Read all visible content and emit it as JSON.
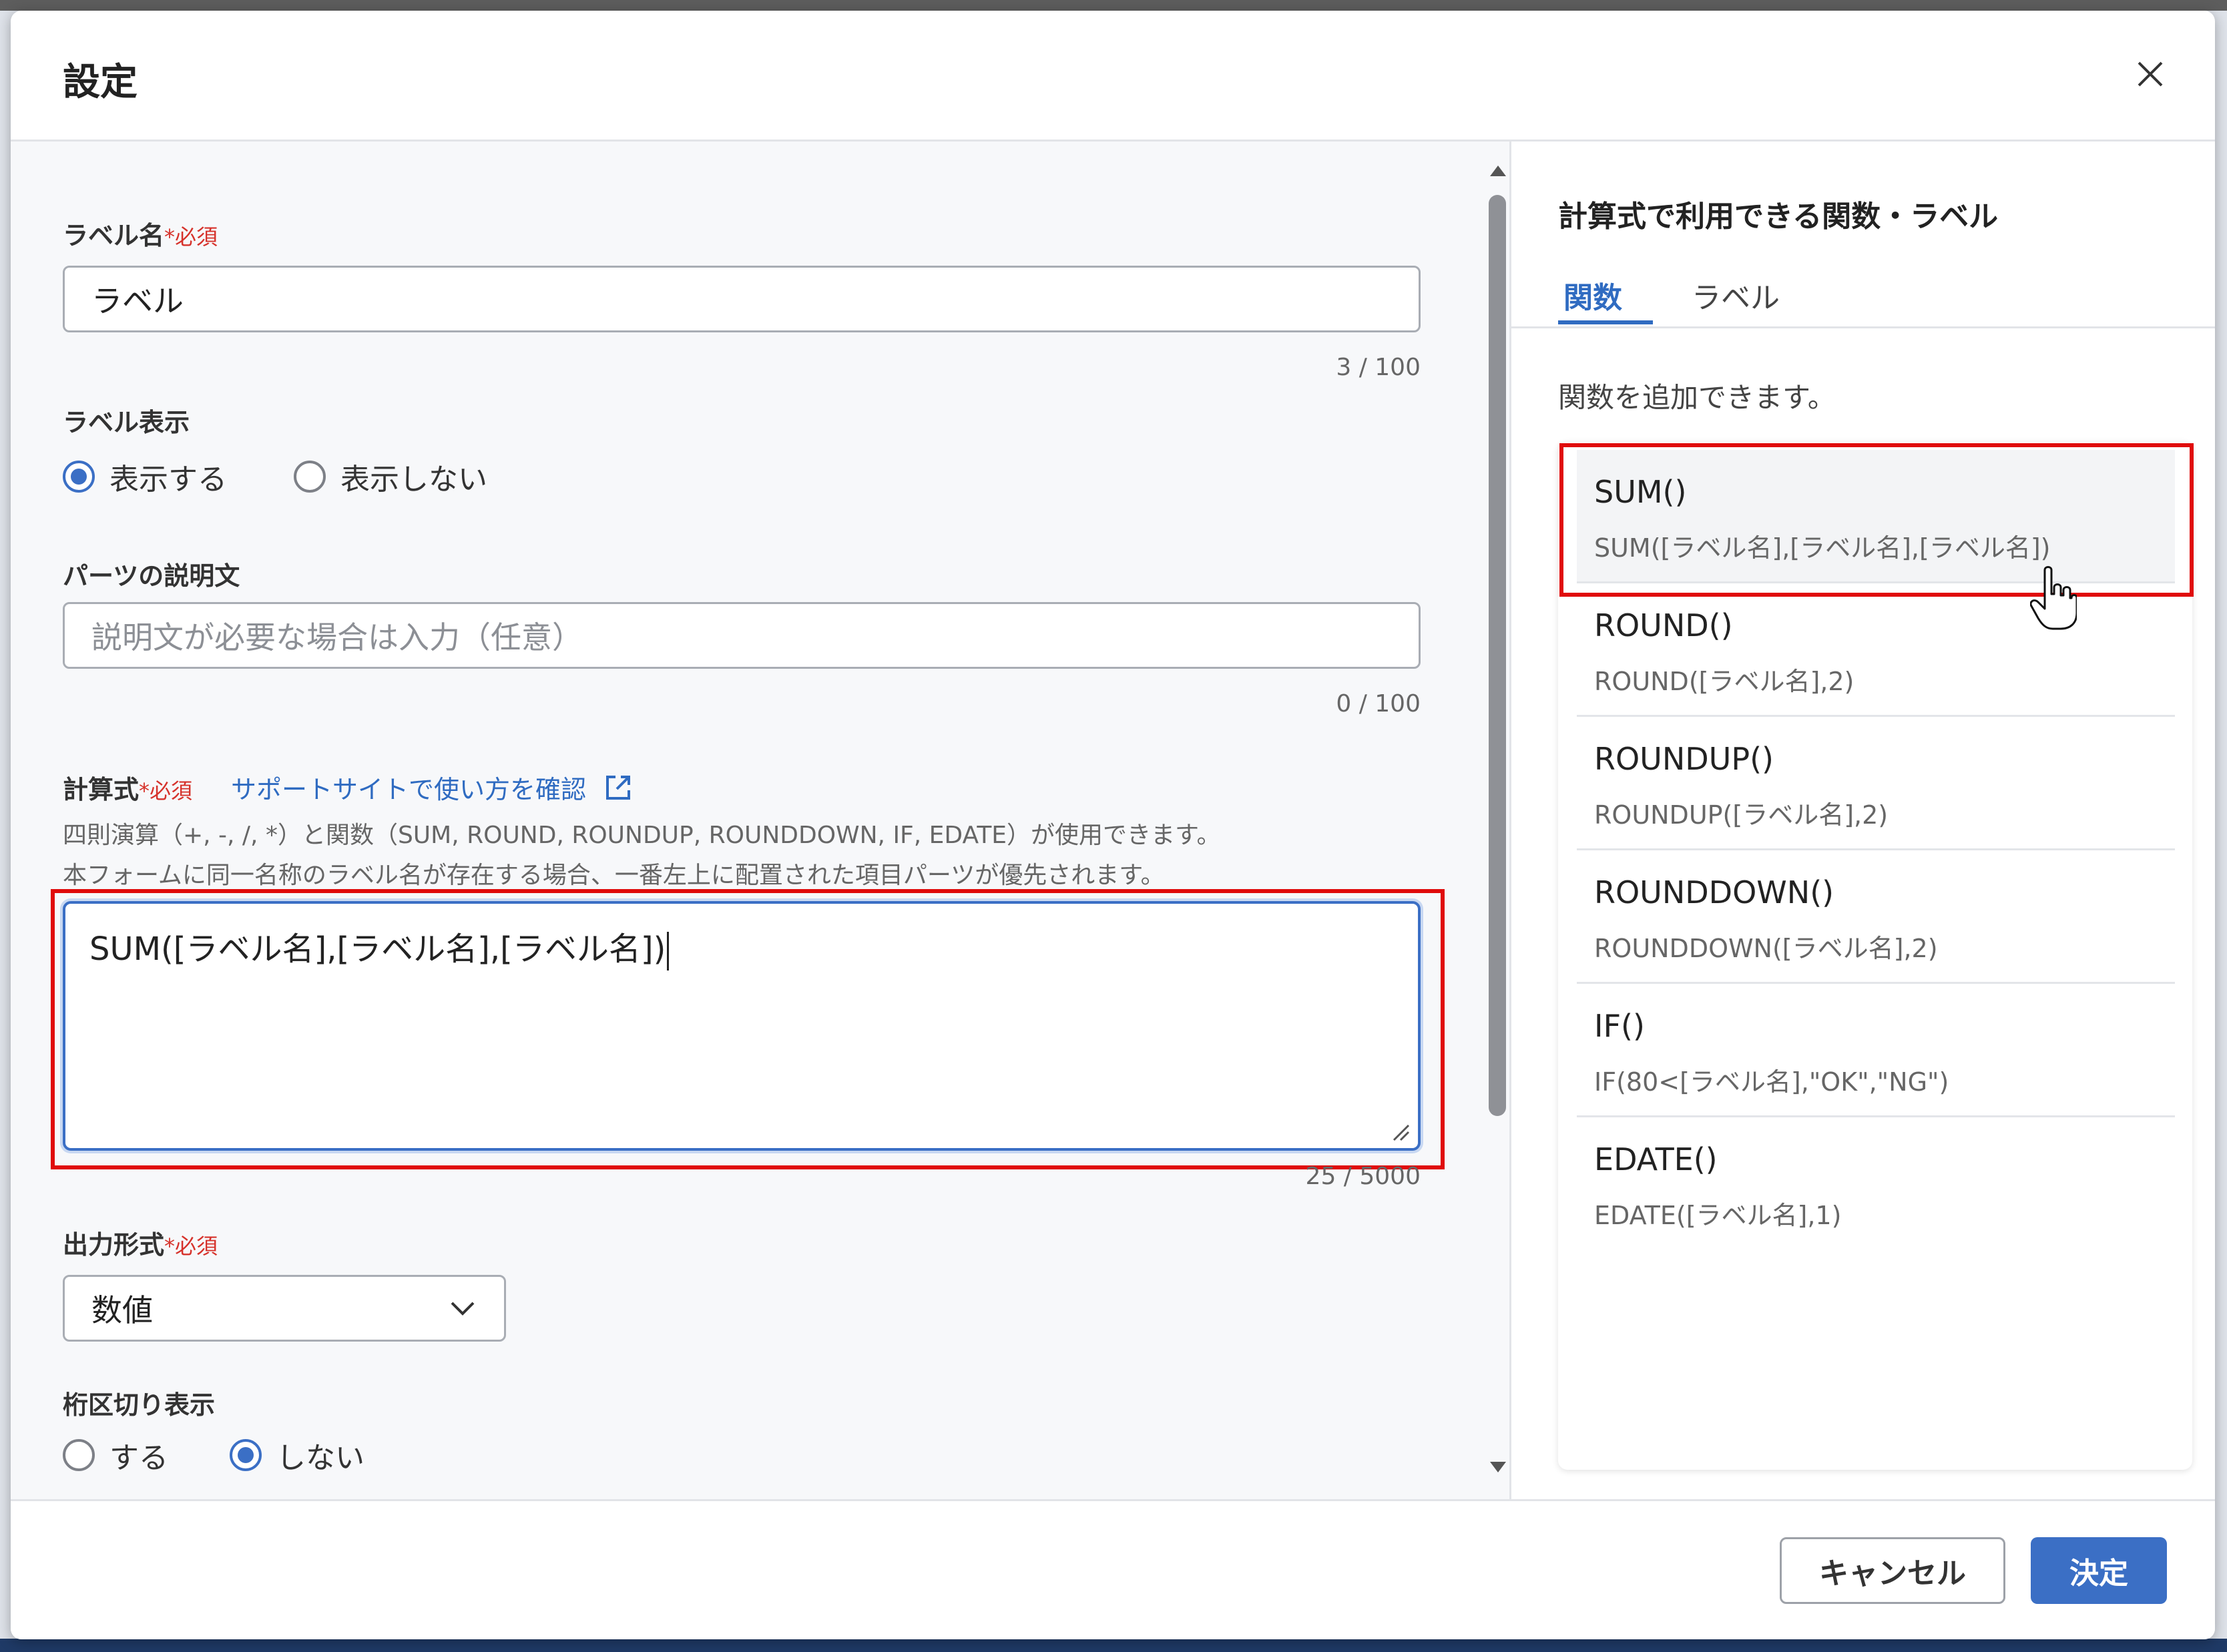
{
  "dialog": {
    "title": "設定",
    "close_icon": "close-icon"
  },
  "form": {
    "label_name": {
      "label": "ラベル名",
      "required": "*必須",
      "value": "ラベル",
      "counter": "3 / 100"
    },
    "label_display": {
      "label": "ラベル表示",
      "options": [
        "表示する",
        "表示しない"
      ],
      "selected": "表示する"
    },
    "description": {
      "label": "パーツの説明文",
      "placeholder": "説明文が必要な場合は入力（任意）",
      "value": "",
      "counter": "0 / 100"
    },
    "formula": {
      "label": "計算式",
      "required": "*必須",
      "support_link": "サポートサイトで使い方を確認",
      "help_line1": "四則演算（+, -, /, *）と関数（SUM, ROUND, ROUNDUP, ROUNDDOWN, IF, EDATE）が使用できます。",
      "help_line2": "本フォームに同一名称のラベル名が存在する場合、一番左上に配置された項目パーツが優先されます。",
      "value": "SUM([ラベル名],[ラベル名],[ラベル名])",
      "counter": "25 / 5000"
    },
    "output_format": {
      "label": "出力形式",
      "required": "*必須",
      "value": "数値"
    },
    "digit_separator": {
      "label": "桁区切り表示",
      "options": [
        "する",
        "しない"
      ],
      "selected": "しない"
    }
  },
  "side_panel": {
    "title": "計算式で利用できる関数・ラベル",
    "tabs": [
      "関数",
      "ラベル"
    ],
    "active_tab": "関数",
    "note": "関数を追加できます。",
    "functions": [
      {
        "name": "SUM()",
        "example": "SUM([ラベル名],[ラベル名],[ラベル名])"
      },
      {
        "name": "ROUND()",
        "example": "ROUND([ラベル名],2)"
      },
      {
        "name": "ROUNDUP()",
        "example": "ROUNDUP([ラベル名],2)"
      },
      {
        "name": "ROUNDDOWN()",
        "example": "ROUNDDOWN([ラベル名],2)"
      },
      {
        "name": "IF()",
        "example": "IF(80<[ラベル名],\"OK\",\"NG\")"
      },
      {
        "name": "EDATE()",
        "example": "EDATE([ラベル名],1)"
      }
    ]
  },
  "footer": {
    "cancel_label": "キャンセル",
    "ok_label": "決定"
  },
  "colors": {
    "accent": "#3b6fc5",
    "required": "#d6322b",
    "highlight_frame": "#e00b0b"
  }
}
